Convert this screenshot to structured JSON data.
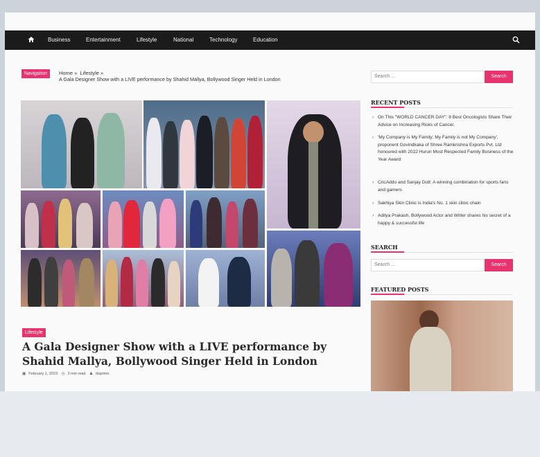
{
  "nav": {
    "items": [
      "Business",
      "Entertainment",
      "Lifestyle",
      "National",
      "Technology",
      "Education"
    ]
  },
  "breadcrumb": {
    "badge": "Navigation",
    "home": "Home »",
    "category": "Lifestyle »",
    "current": "A Gala Designer Show with a LIVE performance by Shahid Mallya, Bollywood Singer Held in London"
  },
  "article": {
    "category": "Lifestyle",
    "title": "A Gala Designer Show with a LIVE performance by Shahid Mallya, Bollywood Singer Held in London",
    "date": "February 1, 2023",
    "read_time": "3 min read",
    "author": "dsprime"
  },
  "sidebar": {
    "top_search": {
      "placeholder": "Search ...",
      "button": "Search"
    },
    "recent_title": "RECENT POSTS",
    "recent_posts": [
      "On This \"WORLD CANCER DAY\": 8 Best Oncologists Share Their Advice on Increasing Risks of Cancer.",
      "'My Company is My Family; My Family is not My Company', proponent Govindkaka of Shree Ramkrishna Exports Pvt. Ltd honoured with 2022 Hurun Most Respected Family Business of the Year Award",
      "CricAddo and Sanjay Dutt: A winning combination for sports fans and gamers",
      "Sakhiya Skin Clinic is India's No. 1 skin clinic chain",
      "Aditya Prakash, Bollywood Actor and Writer shares his secret of a happy & successful life"
    ],
    "search_title": "SEARCH",
    "search": {
      "placeholder": "Search ...",
      "button": "Search"
    },
    "featured_title": "FEATURED POSTS"
  },
  "colors": {
    "accent": "#e8336f",
    "navbar": "#1b1b1b"
  },
  "icons": {
    "nav_home": "home-icon",
    "nav_search": "search-icon"
  }
}
